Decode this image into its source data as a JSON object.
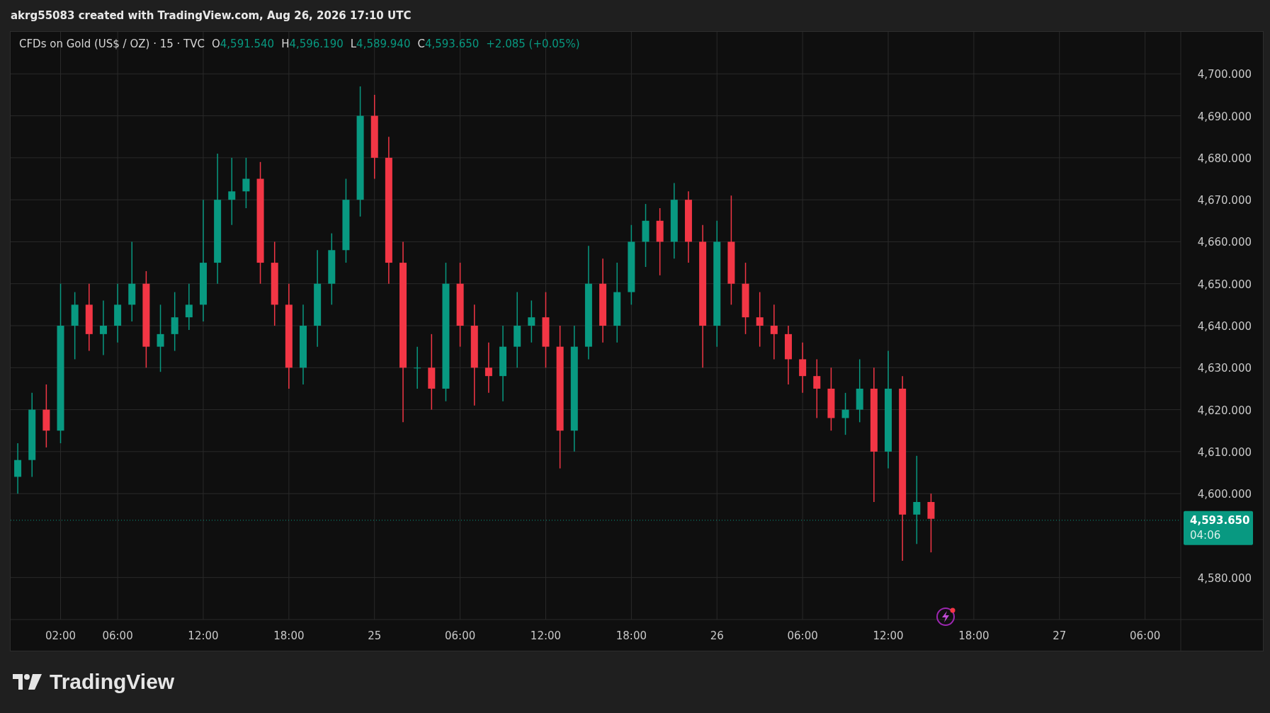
{
  "header": {
    "text": "akrg55083 created with TradingView.com, Aug 26, 2026 17:10 UTC"
  },
  "legend": {
    "symbol": "CFDs on Gold (US$ / OZ) · 15 · TVC",
    "fields": [
      {
        "label": "O",
        "value": "4,591.540"
      },
      {
        "label": "H",
        "value": "4,596.190"
      },
      {
        "label": "L",
        "value": "4,589.940"
      },
      {
        "label": "C",
        "value": "4,593.650"
      }
    ],
    "change": "+2.085 (+0.05%)"
  },
  "chart": {
    "chart_data": {
      "type": "candlestick",
      "grid": true,
      "ylim": [
        4570,
        4710
      ],
      "categories": [
        null,
        null,
        null,
        "02:00",
        null,
        null,
        null,
        "06:00",
        null,
        null,
        null,
        null,
        null,
        "12:00",
        null,
        null,
        null,
        null,
        null,
        "18:00",
        null,
        null,
        null,
        null,
        null,
        "25",
        null,
        null,
        null,
        null,
        null,
        "06:00",
        null,
        null,
        null,
        null,
        null,
        "12:00",
        null,
        null,
        null,
        null,
        null,
        "18:00",
        null,
        null,
        null,
        null,
        null,
        "26",
        null,
        null,
        null,
        null,
        null,
        "06:00",
        null,
        null,
        null,
        null,
        null,
        "12:00",
        null,
        null,
        null,
        null,
        null,
        "18:00",
        null,
        null,
        null,
        null,
        null,
        "27",
        null,
        null,
        null,
        null,
        null,
        "06:00",
        null,
        null
      ],
      "ohlc": [
        [
          4604,
          4612,
          4600,
          4608
        ],
        [
          4608,
          4624,
          4604,
          4620
        ],
        [
          4620,
          4626,
          4611,
          4615
        ],
        [
          4615,
          4650,
          4612,
          4640
        ],
        [
          4640,
          4648,
          4632,
          4645
        ],
        [
          4645,
          4650,
          4634,
          4638
        ],
        [
          4638,
          4646,
          4633,
          4640
        ],
        [
          4640,
          4650,
          4636,
          4645
        ],
        [
          4645,
          4660,
          4641,
          4650
        ],
        [
          4650,
          4653,
          4630,
          4635
        ],
        [
          4635,
          4645,
          4629,
          4638
        ],
        [
          4638,
          4648,
          4634,
          4642
        ],
        [
          4642,
          4650,
          4639,
          4645
        ],
        [
          4645,
          4670,
          4641,
          4655
        ],
        [
          4655,
          4681,
          4650,
          4670
        ],
        [
          4670,
          4680,
          4664,
          4672
        ],
        [
          4672,
          4680,
          4668,
          4675
        ],
        [
          4675,
          4679,
          4650,
          4655
        ],
        [
          4655,
          4660,
          4640,
          4645
        ],
        [
          4645,
          4650,
          4625,
          4630
        ],
        [
          4630,
          4645,
          4626,
          4640
        ],
        [
          4640,
          4658,
          4635,
          4650
        ],
        [
          4650,
          4662,
          4645,
          4658
        ],
        [
          4658,
          4675,
          4655,
          4670
        ],
        [
          4670,
          4697,
          4666,
          4690
        ],
        [
          4690,
          4695,
          4675,
          4680
        ],
        [
          4680,
          4685,
          4650,
          4655
        ],
        [
          4655,
          4660,
          4617,
          4630
        ],
        [
          4630,
          4635,
          4625,
          4630
        ],
        [
          4630,
          4638,
          4620,
          4625
        ],
        [
          4625,
          4655,
          4622,
          4650
        ],
        [
          4650,
          4655,
          4635,
          4640
        ],
        [
          4640,
          4645,
          4621,
          4630
        ],
        [
          4630,
          4636,
          4624,
          4628
        ],
        [
          4628,
          4640,
          4622,
          4635
        ],
        [
          4635,
          4648,
          4630,
          4640
        ],
        [
          4640,
          4646,
          4636,
          4642
        ],
        [
          4642,
          4648,
          4630,
          4635
        ],
        [
          4635,
          4640,
          4606,
          4615
        ],
        [
          4615,
          4640,
          4610,
          4635
        ],
        [
          4635,
          4659,
          4632,
          4650
        ],
        [
          4650,
          4656,
          4636,
          4640
        ],
        [
          4640,
          4655,
          4636,
          4648
        ],
        [
          4648,
          4664,
          4645,
          4660
        ],
        [
          4660,
          4669,
          4654,
          4665
        ],
        [
          4665,
          4668,
          4652,
          4660
        ],
        [
          4660,
          4674,
          4656,
          4670
        ],
        [
          4670,
          4672,
          4655,
          4660
        ],
        [
          4660,
          4664,
          4630,
          4640
        ],
        [
          4640,
          4665,
          4635,
          4660
        ],
        [
          4660,
          4671,
          4645,
          4650
        ],
        [
          4650,
          4655,
          4638,
          4642
        ],
        [
          4642,
          4648,
          4635,
          4640
        ],
        [
          4640,
          4645,
          4632,
          4638
        ],
        [
          4638,
          4640,
          4626,
          4632
        ],
        [
          4632,
          4636,
          4624,
          4628
        ],
        [
          4628,
          4632,
          4618,
          4625
        ],
        [
          4625,
          4630,
          4615,
          4618
        ],
        [
          4618,
          4624,
          4614,
          4620
        ],
        [
          4620,
          4632,
          4617,
          4625
        ],
        [
          4625,
          4630,
          4598,
          4610
        ],
        [
          4610,
          4634,
          4606,
          4625
        ],
        [
          4625,
          4628,
          4584,
          4595
        ],
        [
          4595,
          4609,
          4588,
          4598
        ],
        [
          4598,
          4600,
          4586,
          4594
        ],
        null,
        null,
        null,
        null,
        null,
        null,
        null,
        null,
        null,
        null,
        null,
        null,
        null,
        null,
        null,
        null,
        null
      ],
      "yticks": [
        {
          "value": 4580,
          "label": "4,580.000"
        },
        {
          "value": 4600,
          "label": "4,600.000"
        },
        {
          "value": 4610,
          "label": "4,610.000"
        },
        {
          "value": 4620,
          "label": "4,620.000"
        },
        {
          "value": 4630,
          "label": "4,630.000"
        },
        {
          "value": 4640,
          "label": "4,640.000"
        },
        {
          "value": 4650,
          "label": "4,650.000"
        },
        {
          "value": 4660,
          "label": "4,660.000"
        },
        {
          "value": 4670,
          "label": "4,670.000"
        },
        {
          "value": 4680,
          "label": "4,680.000"
        },
        {
          "value": 4690,
          "label": "4,690.000"
        },
        {
          "value": 4700,
          "label": "4,700.000"
        }
      ],
      "ref_lines": [
        {
          "axis": "y",
          "value": 4593.65,
          "label": "4,593.650",
          "color": "#089981"
        }
      ]
    },
    "countdown": "04:06"
  },
  "logo": {
    "text": "TradingView"
  }
}
